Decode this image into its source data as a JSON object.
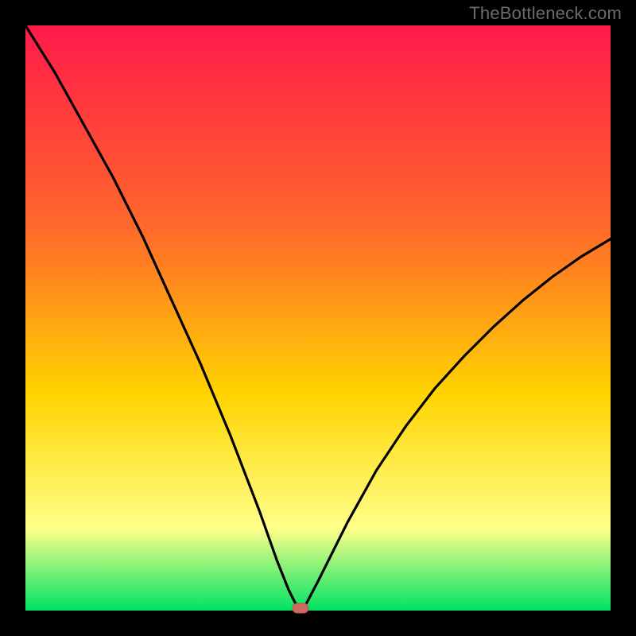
{
  "watermark": "TheBottleneck.com",
  "colors": {
    "frame": "#000000",
    "grad_top": "#ff1a4a",
    "grad_upper": "#ff6a2a",
    "grad_mid": "#ffd400",
    "grad_lowerband": "#ffff8a",
    "grad_bottom": "#00e262",
    "curve": "#000000",
    "marker_fill": "#cc6a60",
    "marker_stroke": "#b85a52"
  },
  "chart_data": {
    "type": "line",
    "title": "",
    "xlabel": "",
    "ylabel": "",
    "xlim": [
      0,
      100
    ],
    "ylim": [
      0,
      100
    ],
    "grid": false,
    "legend": false,
    "min_marker_x": 47,
    "series": [
      {
        "name": "bottleneck-curve",
        "x": [
          0,
          5,
          10,
          15,
          20,
          25,
          30,
          35,
          40,
          43,
          45,
          46,
          47,
          48,
          50,
          55,
          60,
          65,
          70,
          75,
          80,
          85,
          90,
          95,
          100
        ],
        "y": [
          100,
          92,
          83,
          74,
          64,
          53,
          42,
          30,
          17,
          8.5,
          3.5,
          1.5,
          0,
          1.2,
          5,
          15,
          24,
          31.5,
          38,
          43.5,
          48.5,
          53,
          57,
          60.5,
          63.5
        ]
      }
    ]
  }
}
